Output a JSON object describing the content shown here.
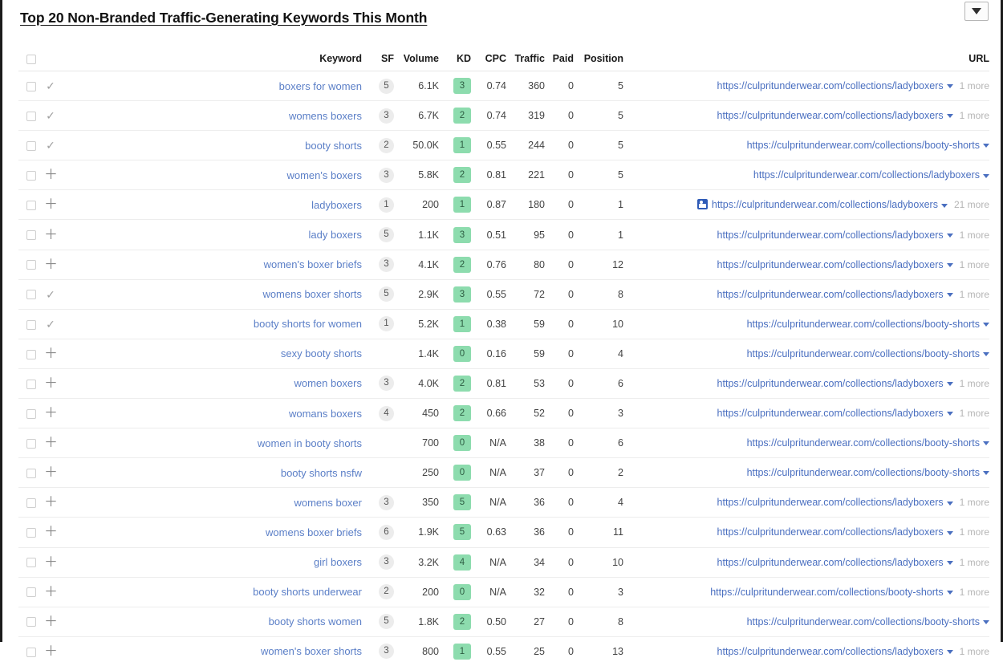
{
  "header": {
    "title": "Top 20 Non-Branded Traffic-Generating Keywords This Month",
    "dropdown_label": ""
  },
  "columns": {
    "checkbox": "",
    "star": "",
    "keyword": "Keyword",
    "sf": "SF",
    "volume": "Volume",
    "kd": "KD",
    "cpc": "CPC",
    "traffic": "Traffic",
    "paid": "Paid",
    "position": "Position",
    "url": "URL"
  },
  "colors": {
    "kd_badge_bg": "#8ddcae",
    "sf_badge_bg": "#ececec",
    "link_blue": "#5b7fc7",
    "url_blue": "#4a6fc0",
    "serp_icon_blue": "#2f5bb7"
  },
  "icons": {
    "dropdown": "caret-down-filled",
    "row_added": "check-icon",
    "row_add": "plus-icon",
    "url_caret": "caret-down-icon",
    "serp_feature": "image-pack-icon"
  },
  "rows": [
    {
      "mark": "check",
      "keyword": "boxers for women",
      "sf": "5",
      "volume": "6.1K",
      "kd": "3",
      "cpc": "0.74",
      "traffic": "360",
      "paid": "0",
      "position": "5",
      "url": "https://culpritunderwear.com/collections/ladyboxers",
      "more": "1 more",
      "serp": false
    },
    {
      "mark": "check",
      "keyword": "womens boxers",
      "sf": "3",
      "volume": "6.7K",
      "kd": "2",
      "cpc": "0.74",
      "traffic": "319",
      "paid": "0",
      "position": "5",
      "url": "https://culpritunderwear.com/collections/ladyboxers",
      "more": "1 more",
      "serp": false
    },
    {
      "mark": "check",
      "keyword": "booty shorts",
      "sf": "2",
      "volume": "50.0K",
      "kd": "1",
      "cpc": "0.55",
      "traffic": "244",
      "paid": "0",
      "position": "5",
      "url": "https://culpritunderwear.com/collections/booty-shorts",
      "more": "",
      "serp": false
    },
    {
      "mark": "plus",
      "keyword": "women's boxers",
      "sf": "3",
      "volume": "5.8K",
      "kd": "2",
      "cpc": "0.81",
      "traffic": "221",
      "paid": "0",
      "position": "5",
      "url": "https://culpritunderwear.com/collections/ladyboxers",
      "more": "",
      "serp": false
    },
    {
      "mark": "plus",
      "keyword": "ladyboxers",
      "sf": "1",
      "volume": "200",
      "kd": "1",
      "cpc": "0.87",
      "traffic": "180",
      "paid": "0",
      "position": "1",
      "url": "https://culpritunderwear.com/collections/ladyboxers",
      "more": "21 more",
      "serp": true
    },
    {
      "mark": "plus",
      "keyword": "lady boxers",
      "sf": "5",
      "volume": "1.1K",
      "kd": "3",
      "cpc": "0.51",
      "traffic": "95",
      "paid": "0",
      "position": "1",
      "url": "https://culpritunderwear.com/collections/ladyboxers",
      "more": "1 more",
      "serp": false
    },
    {
      "mark": "plus",
      "keyword": "women's boxer briefs",
      "sf": "3",
      "volume": "4.1K",
      "kd": "2",
      "cpc": "0.76",
      "traffic": "80",
      "paid": "0",
      "position": "12",
      "url": "https://culpritunderwear.com/collections/ladyboxers",
      "more": "1 more",
      "serp": false
    },
    {
      "mark": "check",
      "keyword": "womens boxer shorts",
      "sf": "5",
      "volume": "2.9K",
      "kd": "3",
      "cpc": "0.55",
      "traffic": "72",
      "paid": "0",
      "position": "8",
      "url": "https://culpritunderwear.com/collections/ladyboxers",
      "more": "1 more",
      "serp": false
    },
    {
      "mark": "check",
      "keyword": "booty shorts for women",
      "sf": "1",
      "volume": "5.2K",
      "kd": "1",
      "cpc": "0.38",
      "traffic": "59",
      "paid": "0",
      "position": "10",
      "url": "https://culpritunderwear.com/collections/booty-shorts",
      "more": "",
      "serp": false
    },
    {
      "mark": "plus",
      "keyword": "sexy booty shorts",
      "sf": "",
      "volume": "1.4K",
      "kd": "0",
      "cpc": "0.16",
      "traffic": "59",
      "paid": "0",
      "position": "4",
      "url": "https://culpritunderwear.com/collections/booty-shorts",
      "more": "",
      "serp": false
    },
    {
      "mark": "plus",
      "keyword": "women boxers",
      "sf": "3",
      "volume": "4.0K",
      "kd": "2",
      "cpc": "0.81",
      "traffic": "53",
      "paid": "0",
      "position": "6",
      "url": "https://culpritunderwear.com/collections/ladyboxers",
      "more": "1 more",
      "serp": false
    },
    {
      "mark": "plus",
      "keyword": "womans boxers",
      "sf": "4",
      "volume": "450",
      "kd": "2",
      "cpc": "0.66",
      "traffic": "52",
      "paid": "0",
      "position": "3",
      "url": "https://culpritunderwear.com/collections/ladyboxers",
      "more": "1 more",
      "serp": false
    },
    {
      "mark": "plus",
      "keyword": "women in booty shorts",
      "sf": "",
      "volume": "700",
      "kd": "0",
      "cpc": "N/A",
      "traffic": "38",
      "paid": "0",
      "position": "6",
      "url": "https://culpritunderwear.com/collections/booty-shorts",
      "more": "",
      "serp": false
    },
    {
      "mark": "plus",
      "keyword": "booty shorts nsfw",
      "sf": "",
      "volume": "250",
      "kd": "0",
      "cpc": "N/A",
      "traffic": "37",
      "paid": "0",
      "position": "2",
      "url": "https://culpritunderwear.com/collections/booty-shorts",
      "more": "",
      "serp": false
    },
    {
      "mark": "plus",
      "keyword": "womens boxer",
      "sf": "3",
      "volume": "350",
      "kd": "5",
      "cpc": "N/A",
      "traffic": "36",
      "paid": "0",
      "position": "4",
      "url": "https://culpritunderwear.com/collections/ladyboxers",
      "more": "1 more",
      "serp": false
    },
    {
      "mark": "plus",
      "keyword": "womens boxer briefs",
      "sf": "6",
      "volume": "1.9K",
      "kd": "5",
      "cpc": "0.63",
      "traffic": "36",
      "paid": "0",
      "position": "11",
      "url": "https://culpritunderwear.com/collections/ladyboxers",
      "more": "1 more",
      "serp": false
    },
    {
      "mark": "plus",
      "keyword": "girl boxers",
      "sf": "3",
      "volume": "3.2K",
      "kd": "4",
      "cpc": "N/A",
      "traffic": "34",
      "paid": "0",
      "position": "10",
      "url": "https://culpritunderwear.com/collections/ladyboxers",
      "more": "1 more",
      "serp": false
    },
    {
      "mark": "plus",
      "keyword": "booty shorts underwear",
      "sf": "2",
      "volume": "200",
      "kd": "0",
      "cpc": "N/A",
      "traffic": "32",
      "paid": "0",
      "position": "3",
      "url": "https://culpritunderwear.com/collections/booty-shorts",
      "more": "1 more",
      "serp": false
    },
    {
      "mark": "plus",
      "keyword": "booty shorts women",
      "sf": "5",
      "volume": "1.8K",
      "kd": "2",
      "cpc": "0.50",
      "traffic": "27",
      "paid": "0",
      "position": "8",
      "url": "https://culpritunderwear.com/collections/booty-shorts",
      "more": "",
      "serp": false
    },
    {
      "mark": "plus",
      "keyword": "women's boxer shorts",
      "sf": "3",
      "volume": "800",
      "kd": "1",
      "cpc": "0.55",
      "traffic": "25",
      "paid": "0",
      "position": "13",
      "url": "https://culpritunderwear.com/collections/ladyboxers",
      "more": "1 more",
      "serp": false
    }
  ]
}
